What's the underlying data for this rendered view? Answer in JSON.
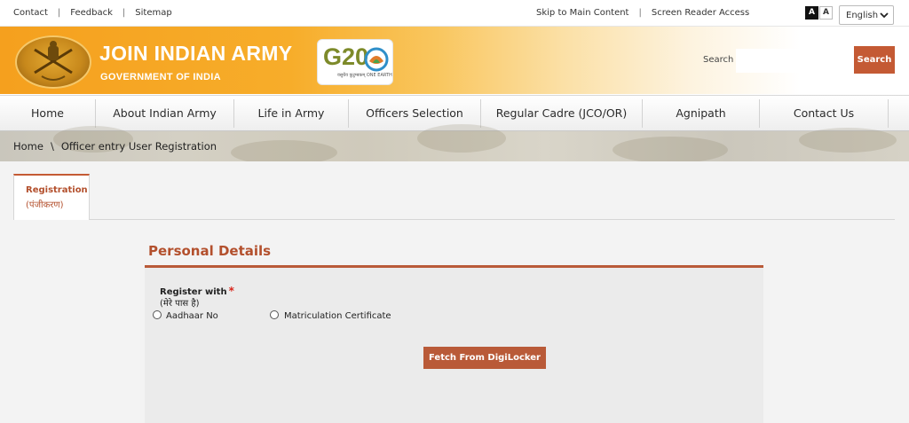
{
  "topbar": {
    "left_links": [
      "Contact",
      "Feedback",
      "Sitemap"
    ],
    "right_links": [
      "Skip to Main Content",
      "Screen Reader Access"
    ],
    "font_dark": "A",
    "font_light": "A",
    "language": "English"
  },
  "header": {
    "title": "JOIN INDIAN ARMY",
    "subtitle": "GOVERNMENT OF INDIA",
    "g20_logo": "G20",
    "g20_tagline": "वसुधैव कुटुम्बकम् ONE EARTH",
    "search_label": "Search",
    "search_value": "",
    "search_button": "Search"
  },
  "nav": {
    "items": [
      "Home",
      "About Indian Army",
      "Life in Army",
      "Officers Selection",
      "Regular Cadre (JCO/OR)",
      "Agnipath",
      "Contact Us"
    ]
  },
  "breadcrumb": {
    "home": "Home",
    "separator": "\\",
    "current": "Officer entry User Registration"
  },
  "tabs": [
    {
      "label": "Registration",
      "label_hi": "(पंजीकरण)"
    }
  ],
  "form": {
    "section_title": "Personal Details",
    "register_with_label": "Register with",
    "required_mark": "*",
    "register_with_label_hi": "(मेरे पास है)",
    "options": [
      "Aadhaar No",
      "Matriculation Certificate"
    ],
    "fetch_button": "Fetch From DigiLocker"
  },
  "colors": {
    "accent": "#c45a34",
    "header_orange": "#f5a01e",
    "required": "#d9261c"
  },
  "icons": {
    "emblem": "army-emblem-icon",
    "language_dropdown": "chevron-down-icon"
  }
}
